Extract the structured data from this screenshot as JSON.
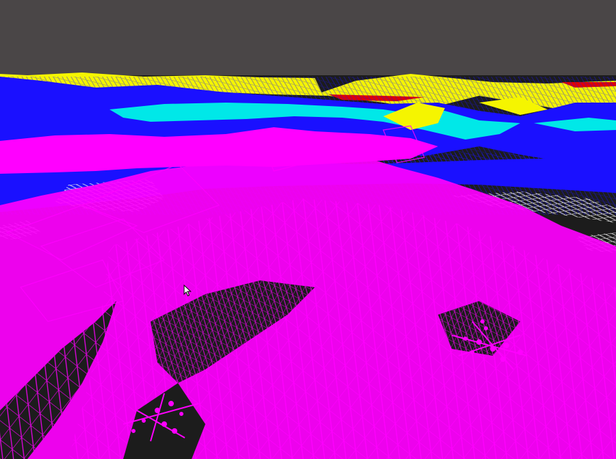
{
  "viewport": {
    "label": "",
    "background_color": "#4a4647",
    "ground_color": "#1c1c1c"
  },
  "terrain": {
    "render_mode": "wireframe",
    "layers": [
      {
        "name": "yellow-band",
        "color": "#f5f500"
      },
      {
        "name": "red-band",
        "color": "#e00000"
      },
      {
        "name": "blue-band",
        "color": "#1a10ff"
      },
      {
        "name": "cyan-band",
        "color": "#00e8e8"
      },
      {
        "name": "magenta-band",
        "color": "#ff00ff"
      },
      {
        "name": "white-band",
        "color": "#e8e8e8"
      },
      {
        "name": "dark-ground",
        "color": "#111111"
      }
    ]
  },
  "markers": [
    {
      "name": "particle-cluster-right",
      "color": "#ff00ff"
    },
    {
      "name": "particle-cluster-left",
      "color": "#ff00ff"
    }
  ],
  "cursor": {
    "icon": "arrow-cursor-icon",
    "color": "#ffffff"
  }
}
